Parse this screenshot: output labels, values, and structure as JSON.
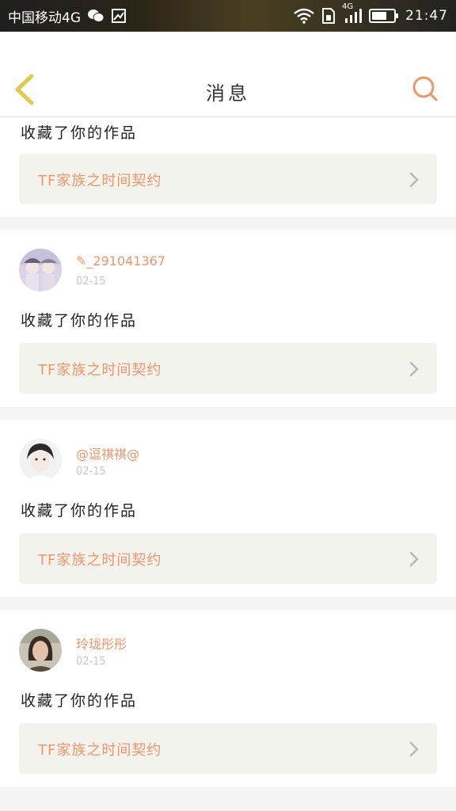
{
  "status_bar": {
    "carrier": "中国移动4G",
    "time": "21:47",
    "network": "4G",
    "icons": [
      "wechat-icon",
      "gallery-icon",
      "wifi-icon",
      "sim-icon",
      "signal-icon",
      "battery-icon"
    ]
  },
  "header": {
    "title": "消息",
    "back_icon": "chevron-left-icon",
    "search_icon": "search-icon"
  },
  "colors": {
    "accent": "#f0956a",
    "back_icon": "#e2c84f",
    "box_bg": "#f3f3ed"
  },
  "notifications": [
    {
      "action": "收藏了你的作品",
      "work_title": "TF家族之时间契约"
    },
    {
      "username": "✎_291041367",
      "date": "02-15",
      "action": "收藏了你的作品",
      "work_title": "TF家族之时间契约"
    },
    {
      "username": "@逗祺祺@",
      "date": "02-15",
      "action": "收藏了你的作品",
      "work_title": "TF家族之时间契约"
    },
    {
      "username": "玲珑彤彤",
      "date": "02-15",
      "action": "收藏了你的作品",
      "work_title": "TF家族之时间契约"
    }
  ]
}
